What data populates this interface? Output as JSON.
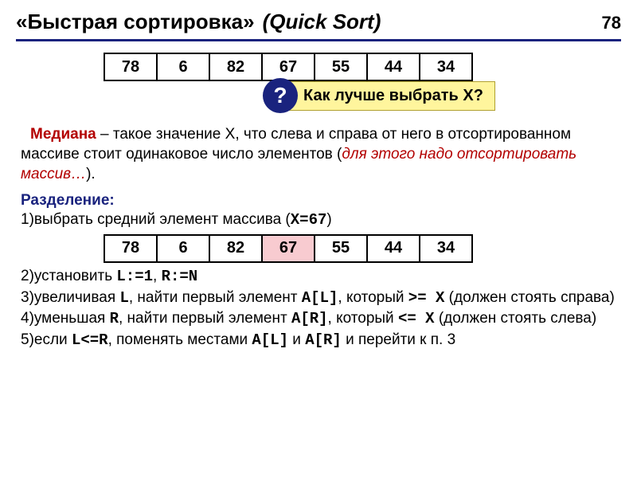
{
  "page_number": "78",
  "title": {
    "ru": "«Быстрая сортировка»",
    "en": "(Quick Sort)"
  },
  "array1": [
    "78",
    "6",
    "82",
    "67",
    "55",
    "44",
    "34"
  ],
  "question": {
    "badge": "?",
    "text": "Как лучше выбрать X?"
  },
  "median": {
    "label": "Медиана",
    "body1": " – такое значение X, что слева и справа от него в отсортированном массиве стоит одинаковое число элементов (",
    "body2": "для этого надо отсортировать массив…",
    "body3": ")."
  },
  "division_label": "Разделение:",
  "step1": {
    "prefix": "1)выбрать средний элемент массива (",
    "mono": "X=67",
    "suffix": ")"
  },
  "array2": [
    "78",
    "6",
    "82",
    "67",
    "55",
    "44",
    "34"
  ],
  "array2_highlight": 3,
  "step2": {
    "prefix": "2)установить ",
    "mono1": "L:=1",
    "sep": ", ",
    "mono2": "R:=N"
  },
  "step3": {
    "prefix": "3)увеличивая ",
    "m1": "L",
    "mid1": ", найти первый элемент ",
    "m2": "A[L]",
    "mid2": ", который ",
    "m3": ">= X",
    "tail": " (должен стоять справа)"
  },
  "step4": {
    "prefix": "4)уменьшая ",
    "m1": "R",
    "mid1": ", найти первый элемент ",
    "m2": "A[R]",
    "mid2": ", который ",
    "m3": "<= X",
    "tail": " (должен стоять слева)"
  },
  "step5": {
    "prefix": "5)если ",
    "m1": "L<=R",
    "mid1": ", поменять местами ",
    "m2": "A[L]",
    "mid2": " и ",
    "m3": "A[R]",
    "tail": " и перейти к п. 3"
  }
}
